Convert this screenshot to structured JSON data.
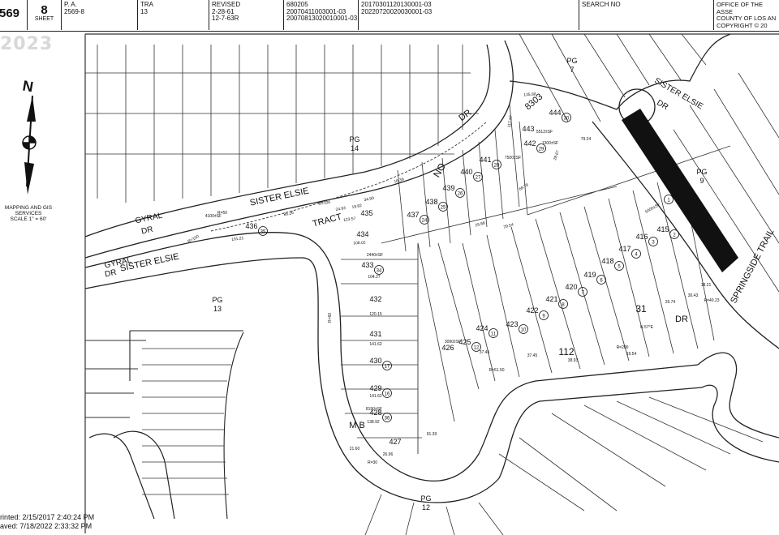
{
  "header": {
    "book": "569",
    "page_num": "8",
    "sheet_label": "SHEET",
    "pa_label": "P. A.",
    "pa_value": "2569-8",
    "tra_label": "TRA",
    "tra_value": "13",
    "revised_label": "REVISED",
    "revised_dates": [
      "2-28-61",
      "12-7-63R"
    ],
    "doc_col1": [
      "680205",
      "20070411003001-03",
      "20070813020010001-03"
    ],
    "doc_col2": [
      "20170301120130001-03",
      "20220720020030001-03"
    ],
    "search_label": "SEARCH NO",
    "office_lines": [
      "OFFICE OF THE ASSE",
      "COUNTY OF LOS AN",
      "COPYRIGHT © 20"
    ]
  },
  "watermark_year": "2023",
  "north_arrow": {
    "letter": "N",
    "lines": [
      "MAPPING AND GIS",
      "SERVICES",
      "SCALE 1\" = 60'"
    ]
  },
  "streets": [
    {
      "text": "SISTER ELSIE"
    },
    {
      "text": "SISTER ELSIE"
    },
    {
      "text": "DR"
    },
    {
      "text": "GYRAL"
    },
    {
      "text": "DR"
    },
    {
      "text": "GYRAL"
    },
    {
      "text": "DR"
    },
    {
      "text": "SISTER ELSIE"
    },
    {
      "text": "DR"
    },
    {
      "text": "SPRINGSIDE TRAIL"
    },
    {
      "text": "DR"
    },
    {
      "text": "TRACT"
    },
    {
      "text": "NO"
    },
    {
      "text": "8303"
    },
    {
      "text": "M B"
    },
    {
      "text": "112"
    },
    {
      "text": "31"
    }
  ],
  "page_refs": [
    {
      "label": "PG",
      "num": "7"
    },
    {
      "label": "PG",
      "num": "14"
    },
    {
      "label": "PG",
      "num": "9"
    },
    {
      "label": "PG",
      "num": "13"
    },
    {
      "label": "PG",
      "num": "12"
    }
  ],
  "lots": [
    {
      "lot": "444",
      "parcel": "30"
    },
    {
      "lot": "443",
      "parcel": ""
    },
    {
      "lot": "442",
      "parcel": "29"
    },
    {
      "lot": "441",
      "parcel": "28"
    },
    {
      "lot": "440",
      "parcel": "27"
    },
    {
      "lot": "439",
      "parcel": "26"
    },
    {
      "lot": "438",
      "parcel": "25"
    },
    {
      "lot": "437",
      "parcel": "24"
    },
    {
      "lot": "436",
      "parcel": "35"
    },
    {
      "lot": "435",
      "parcel": ""
    },
    {
      "lot": "434",
      "parcel": ""
    },
    {
      "lot": "433",
      "parcel": "34"
    },
    {
      "lot": "432",
      "parcel": ""
    },
    {
      "lot": "431",
      "parcel": ""
    },
    {
      "lot": "430",
      "parcel": "17"
    },
    {
      "lot": "429",
      "parcel": "16"
    },
    {
      "lot": "428",
      "parcel": "36"
    },
    {
      "lot": "427",
      "parcel": ""
    },
    {
      "lot": "426",
      "parcel": ""
    },
    {
      "lot": "425",
      "parcel": "12"
    },
    {
      "lot": "424",
      "parcel": "11"
    },
    {
      "lot": "423",
      "parcel": "10"
    },
    {
      "lot": "422",
      "parcel": "9"
    },
    {
      "lot": "421",
      "parcel": "8"
    },
    {
      "lot": "420",
      "parcel": "7"
    },
    {
      "lot": "419",
      "parcel": "6"
    },
    {
      "lot": "418",
      "parcel": "5"
    },
    {
      "lot": "417",
      "parcel": "4"
    },
    {
      "lot": "416",
      "parcel": "3"
    },
    {
      "lot": "415",
      "parcel": "2"
    },
    {
      "lot": "",
      "parcel": "1"
    }
  ],
  "dims": [
    "135.88",
    "117.97",
    "34.90",
    "16.39",
    "123.57",
    "108.02",
    "104.27",
    "120.15",
    "141.62",
    "141.62",
    "138.92",
    "26.96",
    "21.60",
    "91.39",
    "37.45",
    "37.45",
    "38.93",
    "19.54",
    "26.74",
    "30.43",
    "18.21",
    "28.67",
    "79.24",
    "68.78",
    "29.88",
    "29.54",
    "86.26",
    "101.21",
    "24.93",
    "19.82",
    "R=100",
    "R=50",
    "R=150",
    "R=30",
    "R=60",
    "R=200",
    "R=40.23",
    "R=51.50",
    "N 57°E",
    "8190±SF",
    "5000±SF",
    "5512±SF",
    "7500±SF",
    "2440±SF",
    "1300±SF",
    "3090±SF",
    "4100±SF"
  ],
  "footer": {
    "printed": "rinted: 2/15/2017 2:40:24 PM",
    "saved": "aved: 7/18/2022 2:33:32 PM"
  }
}
